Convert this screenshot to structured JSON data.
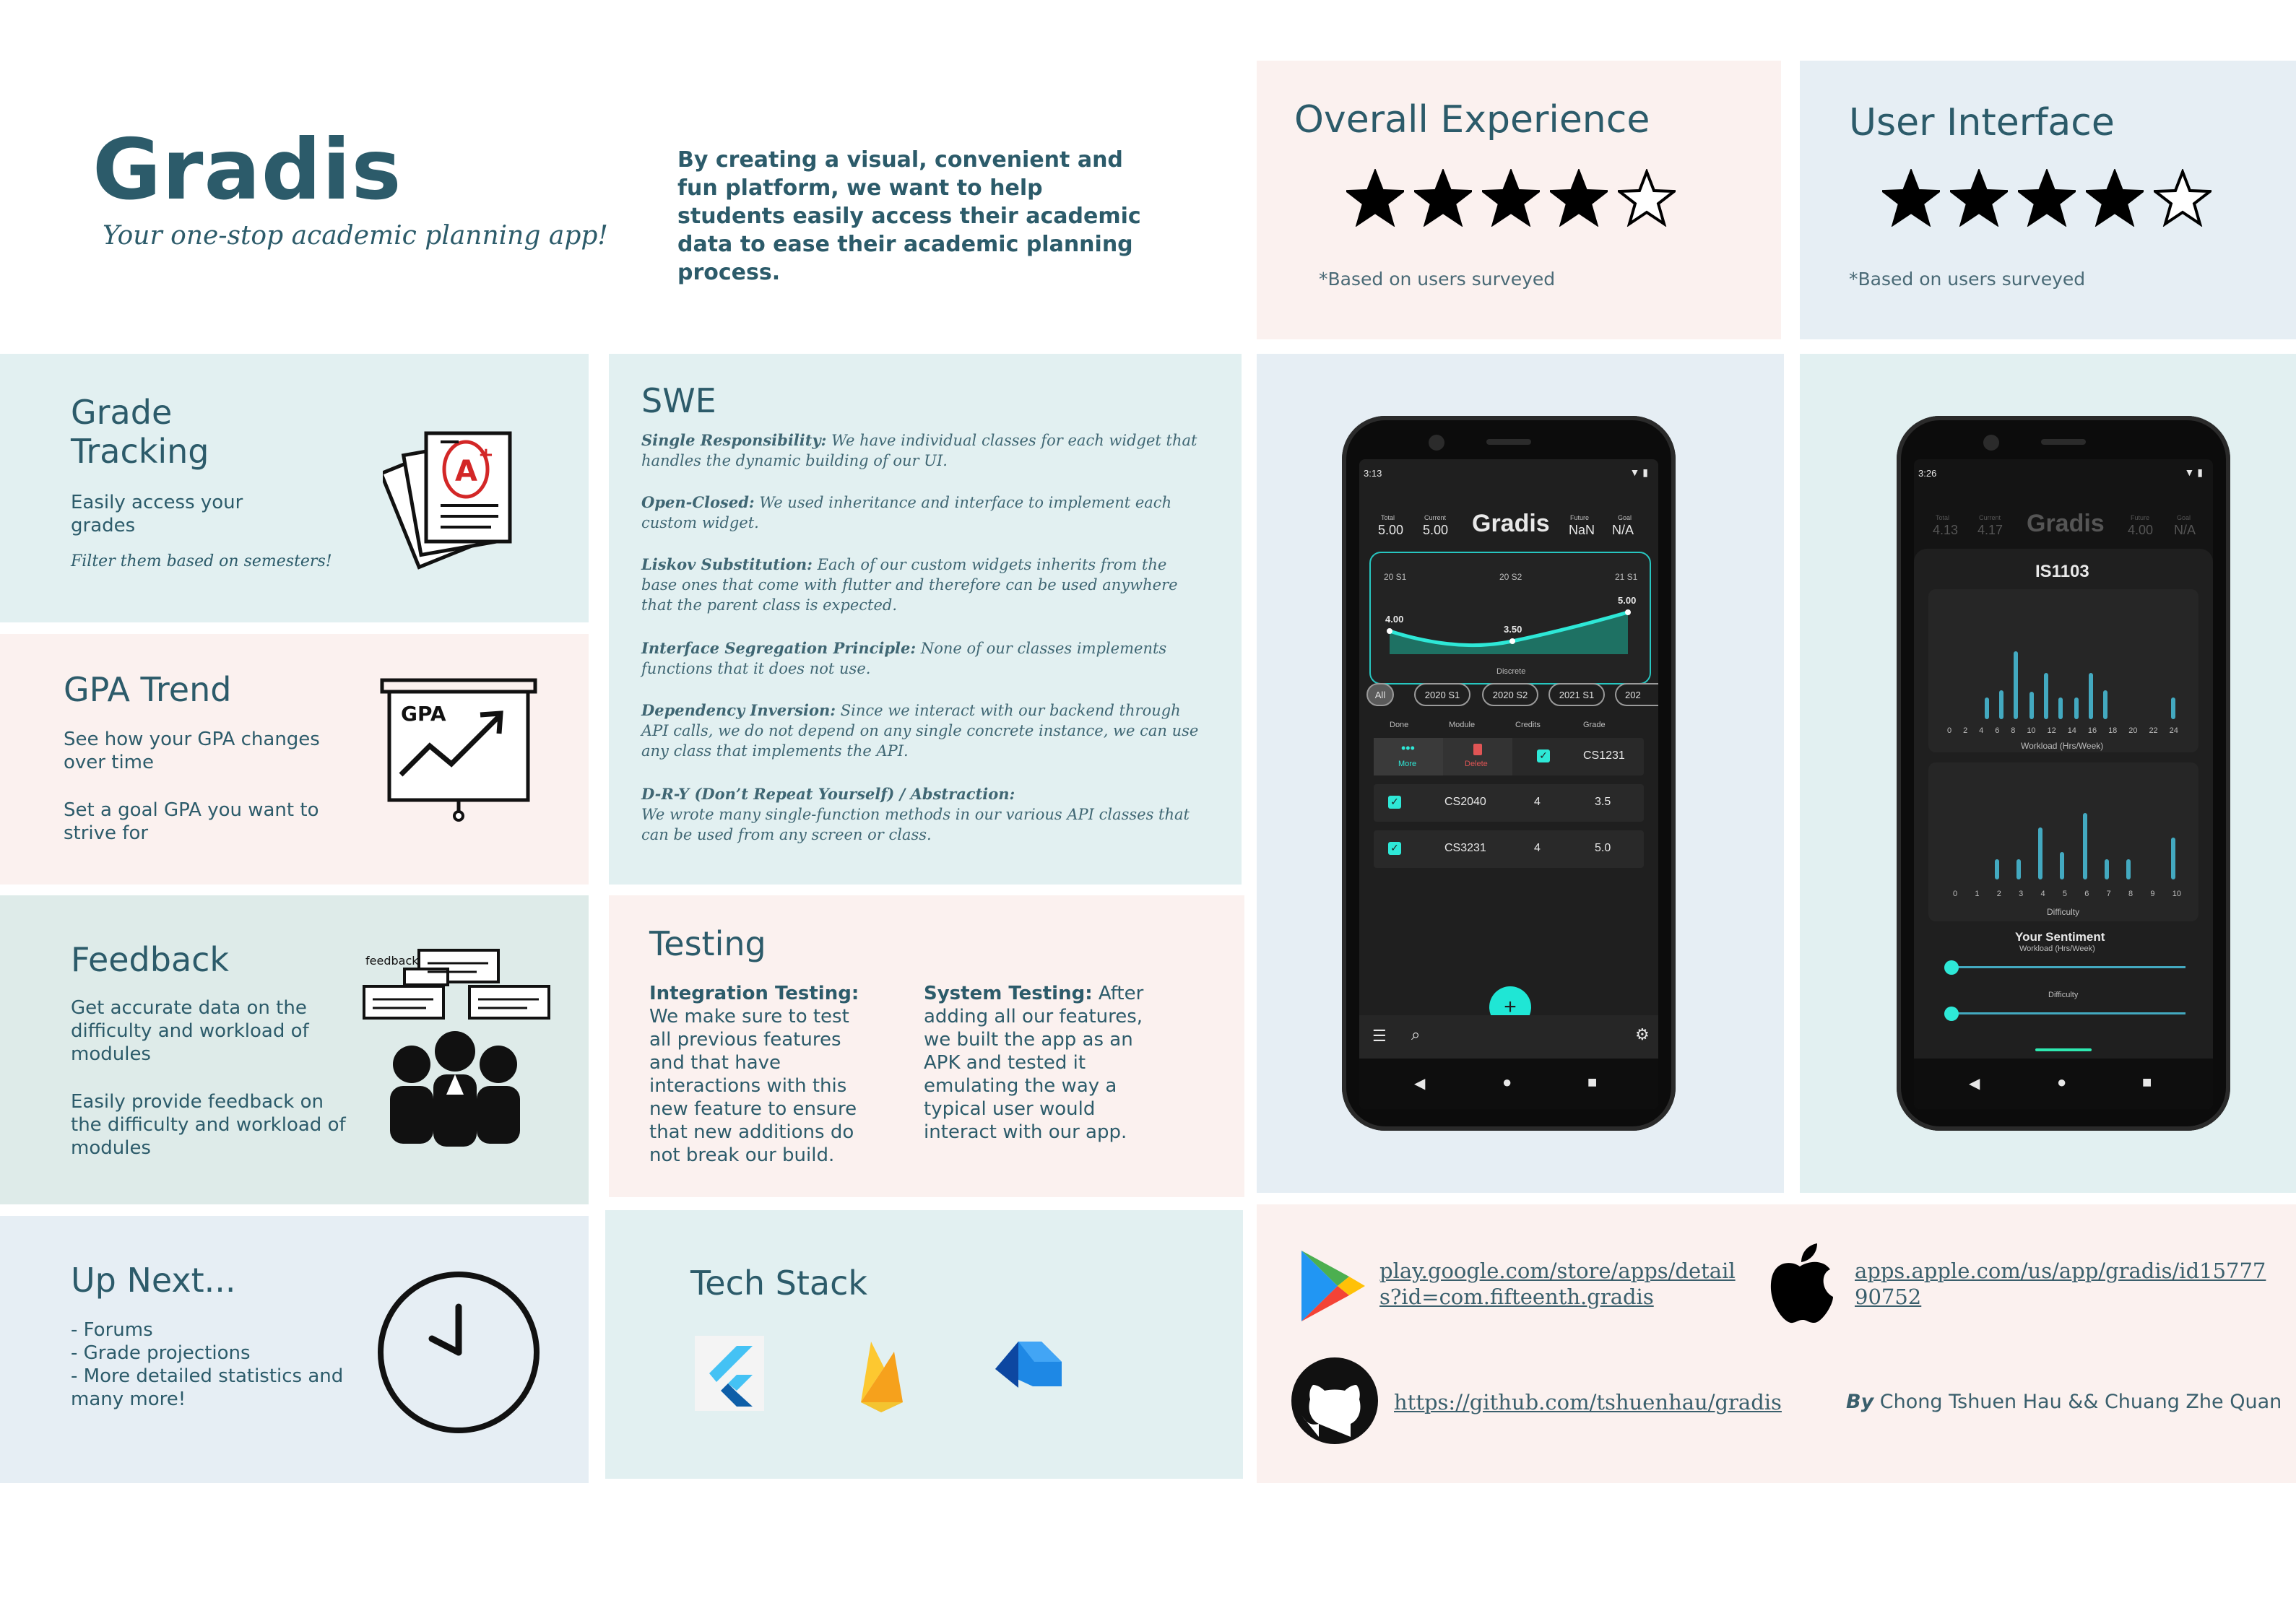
{
  "header": {
    "app_name": "Gradis",
    "tagline": "Your one-stop academic planning app!",
    "mission": "By creating a visual, convenient and fun platform, we want to help students easily access their academic data to ease their academic planning process."
  },
  "ratings": [
    {
      "title": "Overall Experience",
      "stars": 4,
      "max": 5,
      "note": "*Based on users surveyed"
    },
    {
      "title": "User Interface",
      "stars": 4,
      "max": 5,
      "note": "*Based on users surveyed"
    }
  ],
  "features": {
    "grade_tracking": {
      "title_line1": "Grade",
      "title_line2": "Tracking",
      "desc": "Easily access your grades",
      "sub": "Filter them based on semesters!"
    },
    "gpa_trend": {
      "title": "GPA Trend",
      "desc1": "See how your GPA changes over time",
      "desc2": "Set a goal GPA you want to strive for",
      "icon_label": "GPA"
    },
    "feedback": {
      "title": "Feedback",
      "desc1": "Get accurate data on the difficulty and workload of modules",
      "desc2": "Easily provide feedback on the difficulty and workload of modules",
      "icon_label": "feedback"
    },
    "up_next": {
      "title": "Up Next...",
      "items": [
        "- Forums",
        "- Grade projections",
        "- More detailed statistics and many more!"
      ]
    }
  },
  "swe": {
    "title": "SWE",
    "items": [
      {
        "head": "Single Responsibility:",
        "text": " We have individual classes for each widget that handles the dynamic building of our UI."
      },
      {
        "head": "Open-Closed:",
        "text": " We used inheritance and interface to implement each custom widget."
      },
      {
        "head": "Liskov Substitution:",
        "text": " Each of our custom widgets inherits from the base ones that come with flutter and therefore can be used anywhere that the parent class is expected."
      },
      {
        "head": "Interface Segregation Principle:",
        "text": "  None of our classes implements functions that it does not use."
      },
      {
        "head": "Dependency Inversion:",
        "text": "  Since we interact with our backend through API calls, we do not depend on any single concrete instance, we can use any class that implements the API."
      },
      {
        "head": "D-R-Y (Don’t Repeat Yourself) / Abstraction:",
        "text": " We wrote many single-function methods in our various API classes that can be used from any screen or class."
      }
    ]
  },
  "testing": {
    "title": "Testing",
    "integration_head": "Integration Testing:",
    "integration_text": "We make sure to test all previous features and that have interactions with this new feature to ensure that new additions do not break our build.",
    "system_head": "System Testing:",
    "system_text": "After adding all our features, we built the app as an APK and tested it emulating the way a typical user would interact with our app."
  },
  "tech_stack": {
    "title": "Tech Stack",
    "icons": [
      "flutter-icon",
      "firebase-icon",
      "dart-icon"
    ]
  },
  "links": {
    "play_store": "play.google.com/store/apps/details?id=com.fifteenth.gradis",
    "app_store": "apps.apple.com/us/app/gradis/id1577790752",
    "github": "https://github.com/tshuenhau/gradis",
    "credit_by": "By",
    "credit_names": "Chong Tshuen Hau && Chuang Zhe Quan"
  },
  "phone1": {
    "time": "3:13",
    "app_title": "Gradis",
    "stats": [
      {
        "label": "Total",
        "value": "5.00"
      },
      {
        "label": "Current",
        "value": "5.00"
      },
      {
        "label": "Future",
        "value": "NaN"
      },
      {
        "label": "Goal",
        "value": "N/A"
      }
    ],
    "chart_points": [
      {
        "sem": "20 S1",
        "gpa": "4.00"
      },
      {
        "sem": "20 S2",
        "gpa": "3.50"
      },
      {
        "sem": "21 S1",
        "gpa": "5.00"
      }
    ],
    "chart_caption": "Discrete",
    "chips": [
      "All",
      "2020 S1",
      "2020 S2",
      "2021 S1",
      "202"
    ],
    "table_headers": [
      "Done",
      "Module",
      "Credits",
      "Grade"
    ],
    "swipe_actions": {
      "more": "More",
      "delete": "Delete"
    },
    "rows": [
      {
        "module": "CS1231",
        "credits": "",
        "grade": ""
      },
      {
        "module": "CS2040",
        "credits": "4",
        "grade": "3.5"
      },
      {
        "module": "CS3231",
        "credits": "4",
        "grade": "5.0"
      }
    ],
    "fab": "+"
  },
  "phone2": {
    "time": "3:26",
    "app_title": "Gradis",
    "stats": [
      {
        "label": "Total",
        "value": "4.13"
      },
      {
        "label": "Current",
        "value": "4.17"
      },
      {
        "label": "Future",
        "value": "4.00"
      },
      {
        "label": "Goal",
        "value": "N/A"
      }
    ],
    "module": "IS1103",
    "workload_axis": [
      "0",
      "2",
      "4",
      "6",
      "8",
      "10",
      "12",
      "14",
      "16",
      "18",
      "20",
      "22",
      "24"
    ],
    "workload_label": "Workload (Hrs/Week)",
    "difficulty_axis": [
      "0",
      "1",
      "2",
      "3",
      "4",
      "5",
      "6",
      "7",
      "8",
      "9",
      "10"
    ],
    "difficulty_label": "Difficulty",
    "sentiment_title": "Your Sentiment",
    "sentiment_workload": "Workload (Hrs/Week)",
    "sentiment_difficulty": "Difficulty"
  }
}
